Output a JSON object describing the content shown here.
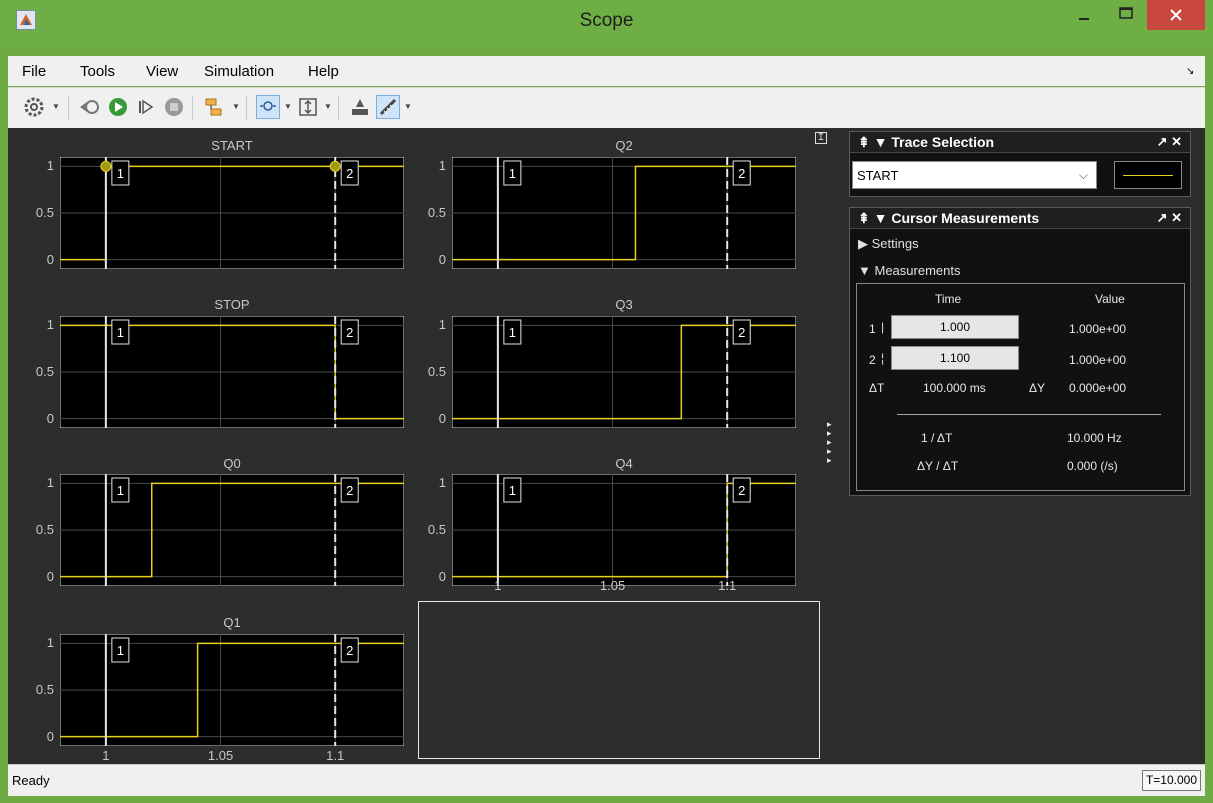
{
  "window": {
    "title": "Scope"
  },
  "menu": {
    "file": "File",
    "tools": "Tools",
    "view": "View",
    "simulation": "Simulation",
    "help": "Help"
  },
  "toolbar_icons": [
    "settings-icon",
    "back-icon",
    "run-icon",
    "step-forward-icon",
    "stop-icon",
    "highlight-simulink-block-icon",
    "zoom-icon",
    "scale-axes-icon",
    "send-to-workspace-icon",
    "cursor-measurements-icon"
  ],
  "signal_color": "#e6d21e",
  "cursor_times": [
    1.0,
    1.1
  ],
  "cursor_labels": [
    "1",
    "2"
  ],
  "plots": [
    {
      "title": "START",
      "x": [
        0.98,
        1.0,
        1.0,
        1.13
      ],
      "y": [
        0,
        0,
        1,
        1
      ],
      "markers": true
    },
    {
      "title": "Q2",
      "x": [
        0.98,
        1.06,
        1.06,
        1.13
      ],
      "y": [
        0,
        0,
        1,
        1
      ]
    },
    {
      "title": "STOP",
      "x": [
        0.98,
        1.1,
        1.1,
        1.13
      ],
      "y": [
        1,
        1,
        0,
        0
      ]
    },
    {
      "title": "Q3",
      "x": [
        0.98,
        1.08,
        1.08,
        1.13
      ],
      "y": [
        0,
        0,
        1,
        1
      ]
    },
    {
      "title": "Q0",
      "x": [
        0.98,
        1.02,
        1.02,
        1.13
      ],
      "y": [
        0,
        0,
        1,
        1
      ]
    },
    {
      "title": "Q4",
      "x": [
        0.98,
        1.1,
        1.1,
        1.13
      ],
      "y": [
        0,
        0,
        1,
        1
      ]
    },
    {
      "title": "Q1",
      "x": [
        0.98,
        1.04,
        1.04,
        1.13
      ],
      "y": [
        0,
        0,
        1,
        1
      ]
    }
  ],
  "yticks": [
    "1",
    "0.5",
    "0"
  ],
  "xticks": [
    "1",
    "1.05",
    "1.1"
  ],
  "trace_selection": {
    "title": "Trace Selection",
    "selected": "START"
  },
  "cursor_measurements": {
    "title": "Cursor Measurements",
    "settings_label": "Settings",
    "measurements_label": "Measurements",
    "time_header": "Time",
    "value_header": "Value",
    "row1_label": "1",
    "row1_time": "1.000",
    "row1_value": "1.000e+00",
    "row2_label": "2",
    "row2_time": "1.100",
    "row2_value": "1.000e+00",
    "dt_label": "ΔT",
    "dt_value": "100.000 ms",
    "dy_label": "ΔY",
    "dy_value": "0.000e+00",
    "inv_dt_label": "1 / ΔT",
    "inv_dt_value": "10.000 Hz",
    "slope_label": "ΔY / ΔT",
    "slope_value": "0.000 (/s)"
  },
  "status": {
    "text": "Ready",
    "time": "T=10.000"
  }
}
